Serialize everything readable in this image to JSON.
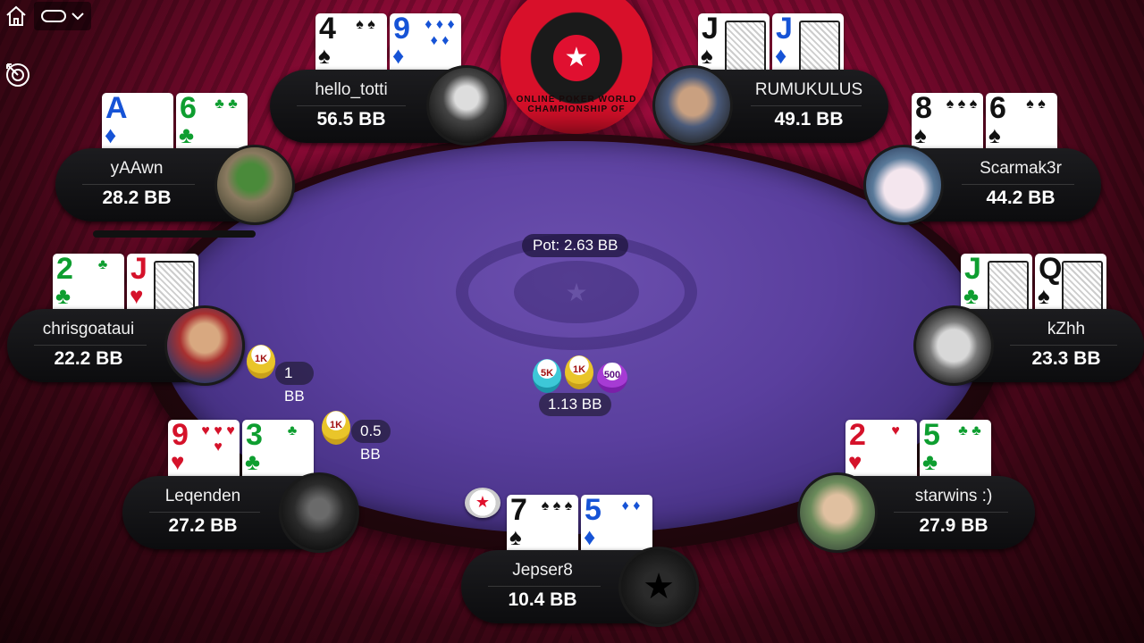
{
  "controls": {
    "home_icon": "home-icon",
    "menu_icon": "menu-pill-icon",
    "chevron_icon": "chevron-down-icon",
    "target_icon": "target-icon"
  },
  "emblem": {
    "text": "ONLINE POKER WORLD CHAMPIONSHIP OF"
  },
  "pot": {
    "label": "Pot: 2.63 BB",
    "center_amount": "1.13 BB",
    "chips": [
      "5K",
      "1K",
      "500"
    ]
  },
  "players": [
    {
      "id": "hello_totti",
      "name": "hello_totti",
      "stack": "56.5 BB",
      "cards": [
        {
          "rank": "4",
          "suit": "♠",
          "color": "black",
          "pips": "♠ ♠"
        },
        {
          "rank": "9",
          "suit": "♦",
          "color": "blue",
          "pips": "♦ ♦ ♦ ♦ ♦"
        }
      ]
    },
    {
      "id": "RUMUKULUS",
      "name": "RUMUKULUS",
      "stack": "49.1 BB",
      "cards": [
        {
          "rank": "J",
          "suit": "♠",
          "color": "black",
          "pips": ""
        },
        {
          "rank": "J",
          "suit": "♦",
          "color": "blue",
          "pips": ""
        }
      ]
    },
    {
      "id": "yAAwn",
      "name": "yAAwn",
      "stack": "28.2 BB",
      "cards": [
        {
          "rank": "A",
          "suit": "♦",
          "color": "blue",
          "pips": ""
        },
        {
          "rank": "6",
          "suit": "♣",
          "color": "green",
          "pips": "♣ ♣"
        }
      ]
    },
    {
      "id": "Scarmak3r",
      "name": "Scarmak3r",
      "stack": "44.2 BB",
      "cards": [
        {
          "rank": "8",
          "suit": "♠",
          "color": "black",
          "pips": "♠ ♠ ♠"
        },
        {
          "rank": "6",
          "suit": "♠",
          "color": "black",
          "pips": "♠ ♠"
        }
      ]
    },
    {
      "id": "chrisgoataui",
      "name": "chrisgoataui",
      "stack": "22.2 BB",
      "bet": "1 BB",
      "bet_chip": "1K",
      "cards": [
        {
          "rank": "2",
          "suit": "♣",
          "color": "green",
          "pips": "♣"
        },
        {
          "rank": "J",
          "suit": "♥",
          "color": "red",
          "pips": ""
        }
      ]
    },
    {
      "id": "kZhh",
      "name": "kZhh",
      "stack": "23.3 BB",
      "cards": [
        {
          "rank": "J",
          "suit": "♣",
          "color": "green",
          "pips": ""
        },
        {
          "rank": "Q",
          "suit": "♠",
          "color": "black",
          "pips": ""
        }
      ]
    },
    {
      "id": "Leqenden",
      "name": "Leqenden",
      "stack": "27.2 BB",
      "bet": "0.5 BB",
      "bet_chip": "1K",
      "cards": [
        {
          "rank": "9",
          "suit": "♥",
          "color": "red",
          "pips": "♥ ♥ ♥ ♥"
        },
        {
          "rank": "3",
          "suit": "♣",
          "color": "green",
          "pips": "♣"
        }
      ]
    },
    {
      "id": "starwins",
      "name": "starwins :)",
      "stack": "27.9 BB",
      "cards": [
        {
          "rank": "2",
          "suit": "♥",
          "color": "red",
          "pips": "♥"
        },
        {
          "rank": "5",
          "suit": "♣",
          "color": "green",
          "pips": "♣ ♣"
        }
      ]
    },
    {
      "id": "Jepser8",
      "name": "Jepser8",
      "stack": "10.4 BB",
      "cards": [
        {
          "rank": "7",
          "suit": "♠",
          "color": "black",
          "pips": "♠ ♠ ♠"
        },
        {
          "rank": "5",
          "suit": "♦",
          "color": "blue",
          "pips": "♦ ♦"
        }
      ]
    }
  ],
  "dealer_button": "★",
  "felt_logo": "★"
}
